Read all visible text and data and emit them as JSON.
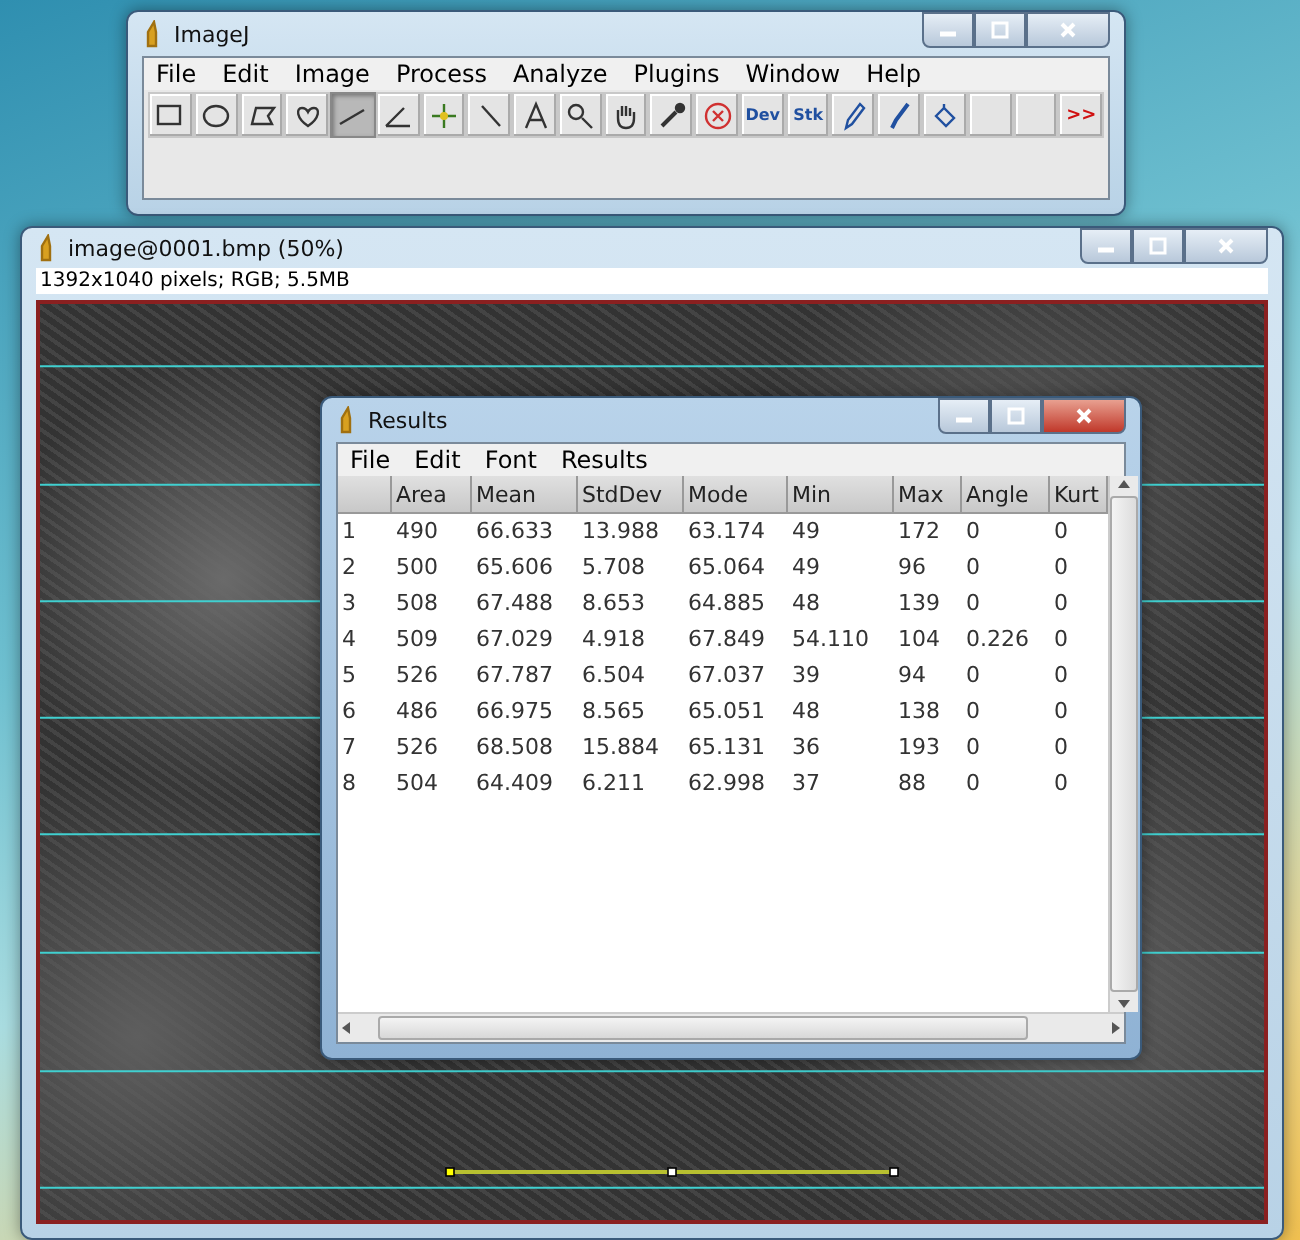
{
  "main_window": {
    "title": "ImageJ",
    "menu": [
      "File",
      "Edit",
      "Image",
      "Process",
      "Analyze",
      "Plugins",
      "Window",
      "Help"
    ],
    "tools": [
      {
        "kind": "rect",
        "selected": false
      },
      {
        "kind": "oval",
        "selected": false
      },
      {
        "kind": "polygon",
        "selected": false
      },
      {
        "kind": "freehand",
        "selected": false
      },
      {
        "kind": "line",
        "selected": true
      },
      {
        "kind": "angle",
        "selected": false
      },
      {
        "kind": "point",
        "selected": false
      },
      {
        "kind": "wand",
        "selected": false
      },
      {
        "kind": "text-tool",
        "selected": false
      },
      {
        "kind": "magnifier",
        "selected": false
      },
      {
        "kind": "hand",
        "selected": false
      },
      {
        "kind": "dropper",
        "selected": false
      },
      {
        "kind": "stop",
        "selected": false
      },
      {
        "kind": "label",
        "label": "Dev",
        "selected": false
      },
      {
        "kind": "label",
        "label": "Stk",
        "selected": false
      },
      {
        "kind": "pencil",
        "selected": false
      },
      {
        "kind": "brush",
        "selected": false
      },
      {
        "kind": "fill",
        "selected": false
      },
      {
        "kind": "empty",
        "selected": false
      },
      {
        "kind": "empty",
        "selected": false
      },
      {
        "kind": "more",
        "label": ">>",
        "selected": false
      }
    ]
  },
  "image_window": {
    "title": "image@0001.bmp (50%)",
    "info": "1392x1040 pixels; RGB; 5.5MB"
  },
  "results_window": {
    "title": "Results",
    "menu": [
      "File",
      "Edit",
      "Font",
      "Results"
    ],
    "columns": [
      "",
      "Area",
      "Mean",
      "StdDev",
      "Mode",
      "Min",
      "Max",
      "Angle",
      "Kurt"
    ],
    "rows": [
      [
        "1",
        "490",
        "66.633",
        "13.988",
        "63.174",
        "49",
        "172",
        "0",
        "0"
      ],
      [
        "2",
        "500",
        "65.606",
        "5.708",
        "65.064",
        "49",
        "96",
        "0",
        "0"
      ],
      [
        "3",
        "508",
        "67.488",
        "8.653",
        "64.885",
        "48",
        "139",
        "0",
        "0"
      ],
      [
        "4",
        "509",
        "67.029",
        "4.918",
        "67.849",
        "54.110",
        "104",
        "0.226",
        "0"
      ],
      [
        "5",
        "526",
        "67.787",
        "6.504",
        "67.037",
        "39",
        "94",
        "0",
        "0"
      ],
      [
        "6",
        "486",
        "66.975",
        "8.565",
        "65.051",
        "48",
        "138",
        "0",
        "0"
      ],
      [
        "7",
        "526",
        "68.508",
        "15.884",
        "65.131",
        "36",
        "193",
        "0",
        "0"
      ],
      [
        "8",
        "504",
        "64.409",
        "6.211",
        "62.998",
        "37",
        "88",
        "0",
        "0"
      ]
    ]
  }
}
